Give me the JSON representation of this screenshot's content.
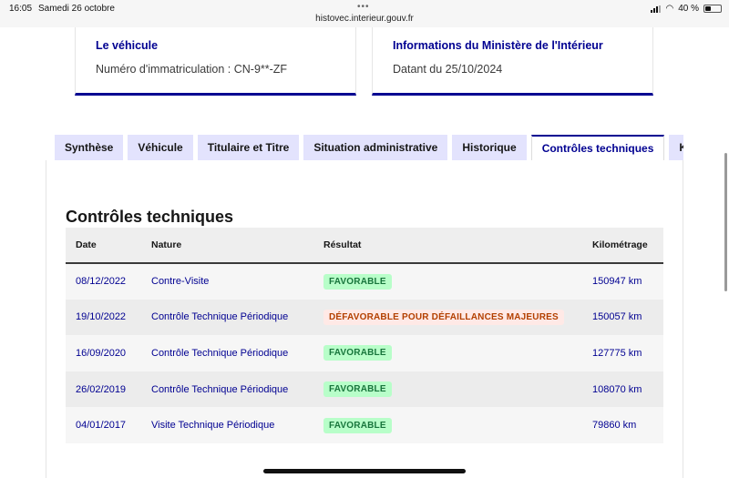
{
  "status_bar": {
    "time": "16:05",
    "date": "Samedi 26 octobre",
    "url": "histovec.interieur.gouv.fr",
    "battery": "40 %",
    "battery_level": 0.4
  },
  "cards": {
    "vehicle": {
      "title": "Le véhicule",
      "text": "Numéro d'immatriculation : CN-9**-ZF"
    },
    "ministry": {
      "title": "Informations du Ministère de l'Intérieur",
      "text": "Datant du 25/10/2024"
    }
  },
  "tabs": [
    {
      "label": "Synthèse",
      "active": false
    },
    {
      "label": "Véhicule",
      "active": false
    },
    {
      "label": "Titulaire et Titre",
      "active": false
    },
    {
      "label": "Situation administrative",
      "active": false
    },
    {
      "label": "Historique",
      "active": false
    },
    {
      "label": "Contrôles techniques",
      "active": true
    },
    {
      "label": "Kilométrage",
      "active": false
    }
  ],
  "section": {
    "title": "Contrôles techniques"
  },
  "table": {
    "headers": {
      "date": "Date",
      "nature": "Nature",
      "result": "Résultat",
      "mileage": "Kilométrage"
    },
    "rows": [
      {
        "date": "08/12/2022",
        "nature": "Contre-Visite",
        "result": "FAVORABLE",
        "result_status": "ok",
        "mileage": "150947 km"
      },
      {
        "date": "19/10/2022",
        "nature": "Contrôle Technique Périodique",
        "result": "DÉFAVORABLE POUR DÉFAILLANCES MAJEURES",
        "result_status": "ko",
        "mileage": "150057 km"
      },
      {
        "date": "16/09/2020",
        "nature": "Contrôle Technique Périodique",
        "result": "FAVORABLE",
        "result_status": "ok",
        "mileage": "127775 km"
      },
      {
        "date": "26/02/2019",
        "nature": "Contrôle Technique Périodique",
        "result": "FAVORABLE",
        "result_status": "ok",
        "mileage": "108070 km"
      },
      {
        "date": "04/01/2017",
        "nature": "Visite Technique Périodique",
        "result": "FAVORABLE",
        "result_status": "ok",
        "mileage": "79860 km"
      }
    ]
  },
  "colors": {
    "brand_blue": "#000091",
    "tab_inactive_bg": "#e3e3fd",
    "success_bg": "#b8fec9",
    "success_text": "#18753c",
    "error_bg": "#ffe9e6",
    "error_text": "#b34000"
  }
}
